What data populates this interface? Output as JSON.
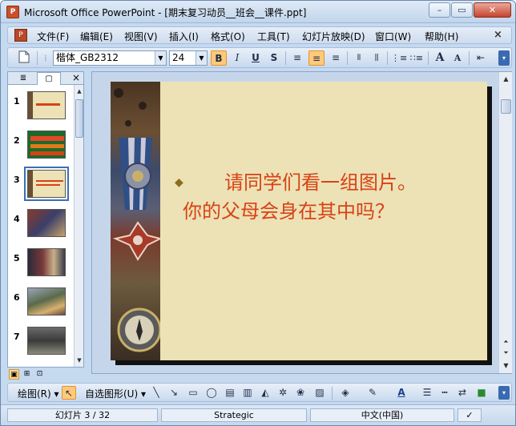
{
  "window": {
    "app_icon_label": "P",
    "title": "Microsoft Office PowerPoint - [期末复习动员__班会__课件.ppt]",
    "minimize": "–",
    "maximize": "▭",
    "close": "✕"
  },
  "menubar": {
    "icon_label": "P",
    "items": [
      {
        "label": "文件(F)"
      },
      {
        "label": "编辑(E)"
      },
      {
        "label": "视图(V)"
      },
      {
        "label": "插入(I)"
      },
      {
        "label": "格式(O)"
      },
      {
        "label": "工具(T)"
      },
      {
        "label": "幻灯片放映(D)"
      },
      {
        "label": "窗口(W)"
      },
      {
        "label": "帮助(H)"
      }
    ],
    "close_doc": "×"
  },
  "toolbar": {
    "font_name": "楷体_GB2312",
    "font_size": "24",
    "bold": "B",
    "italic": "I",
    "underline": "U",
    "shadow": "S",
    "align_left": "≡",
    "align_center": "≡",
    "align_right": "≡",
    "grow_font": "A",
    "shrink_font": "A",
    "new_icon": "new-document-icon"
  },
  "left_pane": {
    "tab_outline": "≣",
    "tab_slides": "▢",
    "close": "×",
    "slides": [
      {
        "number": "1"
      },
      {
        "number": "2"
      },
      {
        "number": "3",
        "selected": true
      },
      {
        "number": "4"
      },
      {
        "number": "5"
      },
      {
        "number": "6"
      },
      {
        "number": "7"
      }
    ]
  },
  "slide": {
    "bullet": "◆",
    "line1": "请同学们看一组图片。",
    "line2": "你的父母会身在其中吗？"
  },
  "drawbar": {
    "draw_label": "绘图(R)",
    "autoshape_label": "自选图形(U)",
    "font_color_letter": "A"
  },
  "statusbar": {
    "slide_info": "幻灯片 3 / 32",
    "design": "Strategic",
    "language": "中文(中国)"
  },
  "colors": {
    "slide_text": "#d84215",
    "slide_bg": "#ece2b6",
    "selection": "#ffc97a"
  }
}
